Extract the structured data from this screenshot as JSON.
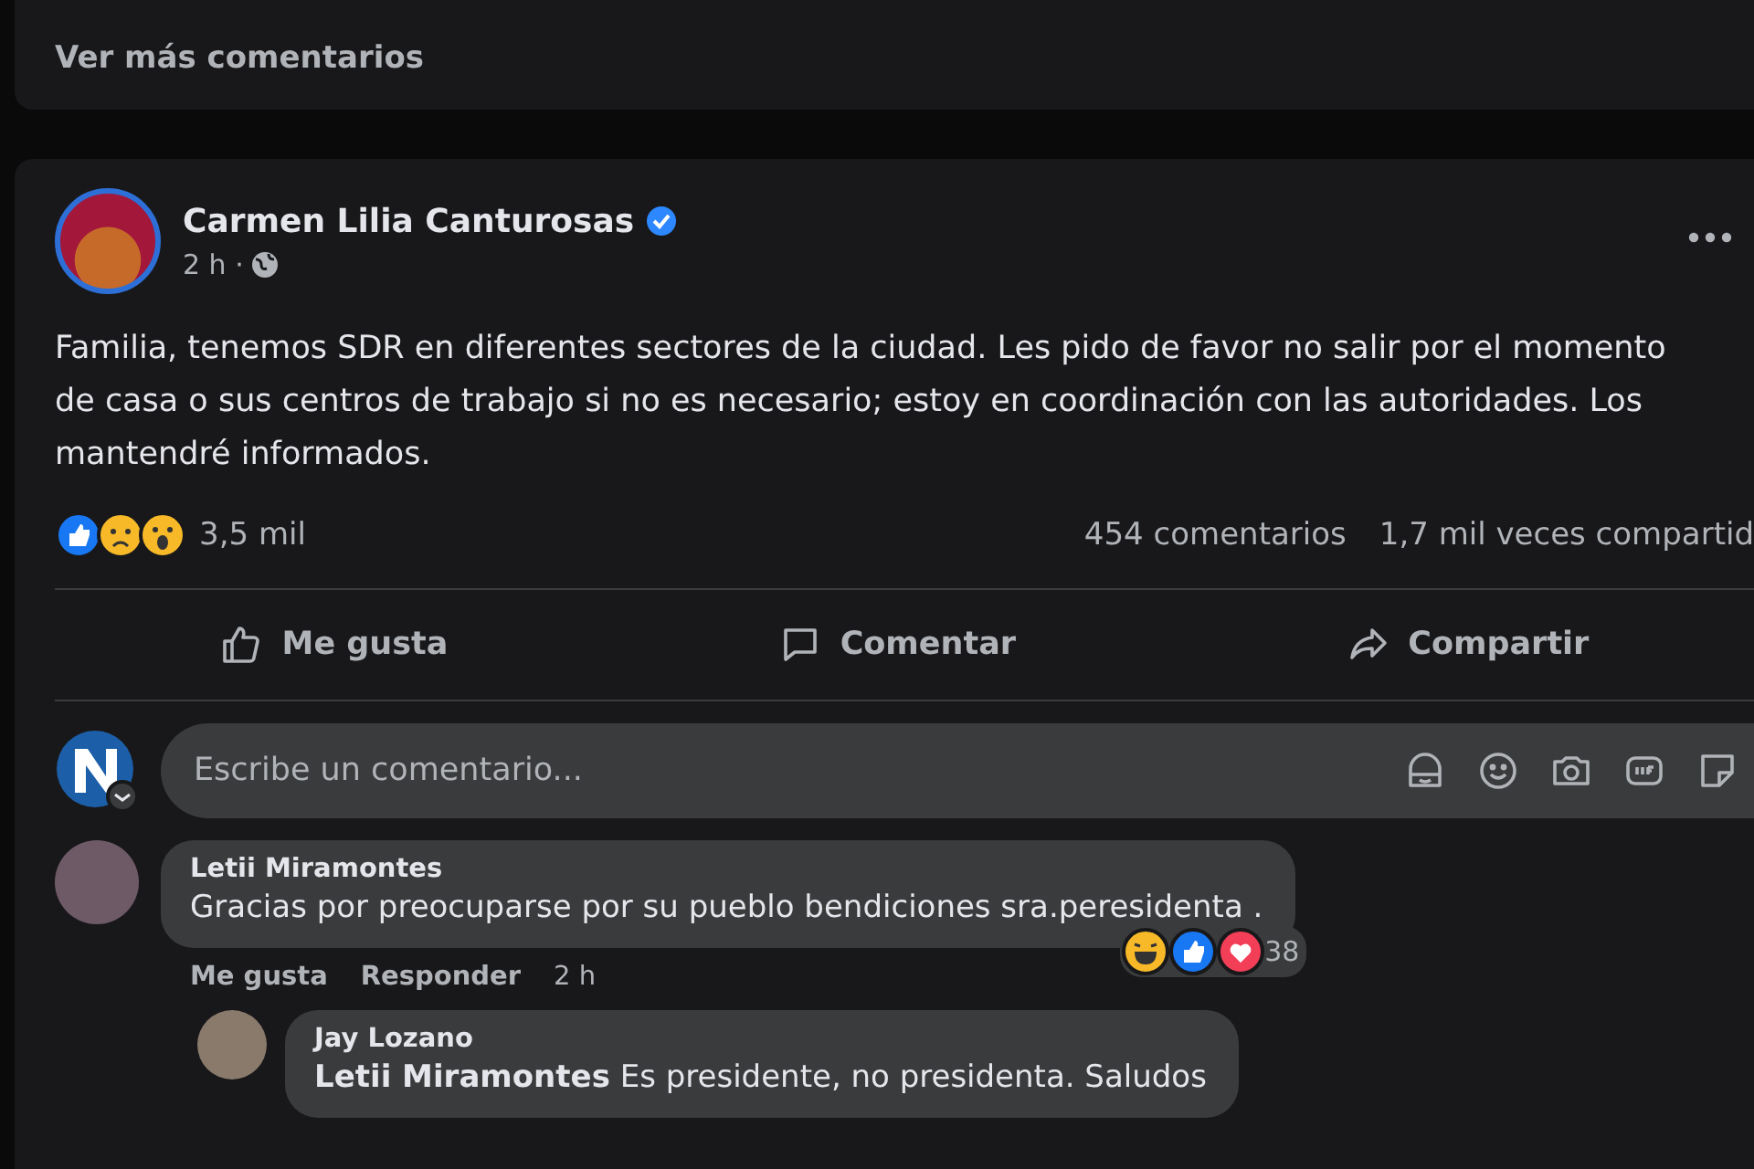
{
  "previous_post": {
    "more_comments_link": "Ver más comentarios"
  },
  "post": {
    "author": "Carmen Lilia Canturosas",
    "verified": true,
    "time": "2 h ·",
    "text": "Familia, tenemos SDR en diferentes sectores de la ciudad. Les pido de favor no salir por el momento de casa o sus centros de trabajo si no es necesario; estoy en coordinación con las autoridades. Los mantendré informados.",
    "reaction_count": "3,5 mil",
    "comments_count": "454 comentarios",
    "shares_count": "1,7 mil veces compartid",
    "actions": [
      {
        "kind": "like",
        "label": "Me gusta"
      },
      {
        "kind": "comment",
        "label": "Comentar"
      },
      {
        "kind": "share",
        "label": "Compartir"
      }
    ]
  },
  "comment_box": {
    "placeholder": "Escribe un comentario..."
  },
  "comments": [
    {
      "author": "Letii Miramontes",
      "text": "Gracias por preocuparse por su pueblo bendiciones sra.peresidenta .",
      "reaction_count": "38",
      "actions": [
        "Me gusta",
        "Responder"
      ],
      "time": "2 h",
      "replies": [
        {
          "author": "Jay Lozano",
          "text": "**Letii Miramontes** Es presidente, no presidenta. Saludos"
        }
      ]
    }
  ]
}
